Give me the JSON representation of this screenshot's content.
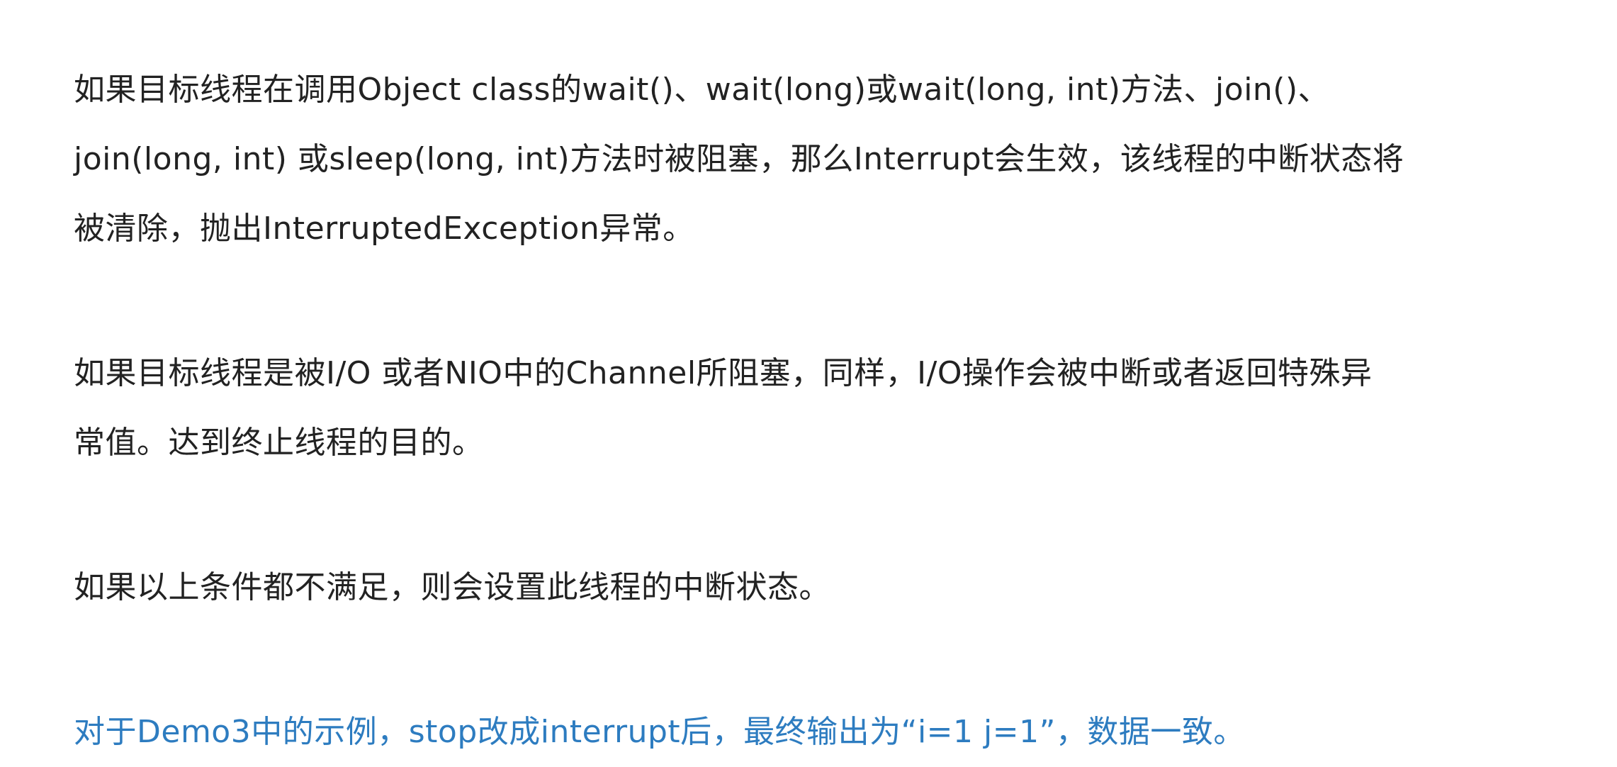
{
  "article": {
    "paragraphs": [
      {
        "lines": [
          "如果目标线程在调用Object  class的wait()、wait(long)或wait(long,  int)方法、join()、",
          "join(long, int) 或sleep(long, int)方法时被阻塞，那么Interrupt会生效，该线程的中断状态将",
          "被清除，抛出InterruptedException异常。"
        ]
      },
      {
        "lines": [
          "如果目标线程是被I/O 或者NIO中的Channel所阻塞，同样，I/O操作会被中断或者返回特殊异",
          "常值。达到终止线程的目的。"
        ]
      },
      {
        "lines": [
          "如果以上条件都不满足，则会设置此线程的中断状态。"
        ]
      },
      {
        "lines": [
          "对于Demo3中的示例，stop改成interrupt后，最终输出为“i=1  j=1”，数据一致。"
        ]
      }
    ]
  },
  "colors": {
    "text": "#222222",
    "accent": "#2d7cc0",
    "background": "#ffffff"
  }
}
